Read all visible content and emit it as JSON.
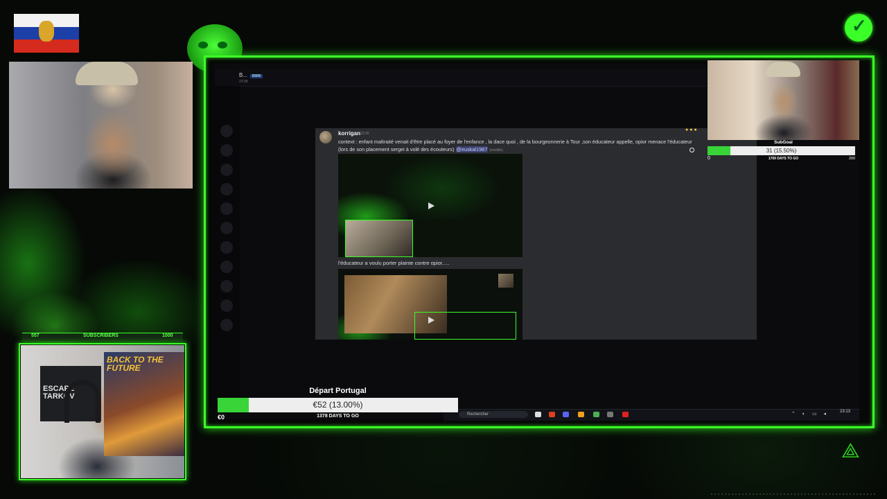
{
  "discord": {
    "channel_title": "B...",
    "channel_tag": "BMW",
    "header_time": "23:08",
    "author": "korrigan",
    "time": "22:26",
    "message_text": "context : enfant maltraité venait d'être placé au foyer de l'enfance , la dace quoi , de la bourgeonnerie à Tour ,son éducateur appelle, opior menace l'éducateur (lors de son placement sergei à volé des écouteurs)",
    "mention": "@euskal1987",
    "edited": "(modifié)",
    "caption": "l'éducateur a voulu porter plainte contre opior....."
  },
  "taskbar": {
    "search_placeholder": "Rechercher",
    "clock": "23:13"
  },
  "subgoal": {
    "title": "SubGoal",
    "value_text": "31 (15.50%)",
    "progress_fraction": 0.155,
    "min": "0",
    "days": "1769 DAYS TO GO",
    "max": "200"
  },
  "subscribers": {
    "current": "557",
    "label": "SUBSCRIBERS",
    "target": "1000"
  },
  "goal": {
    "title": "Départ Portugal",
    "value_text": "€52 (13.00%)",
    "progress_fraction": 0.13,
    "min": "€0",
    "days": "1378 DAYS TO GO"
  },
  "posters": {
    "movie": "BACK TO THE FUTURE",
    "game": "ESCAPE TARKOV"
  },
  "colors": {
    "accent": "#3bff28",
    "progress": "#39d438",
    "discord_panel": "#2b2c30"
  }
}
